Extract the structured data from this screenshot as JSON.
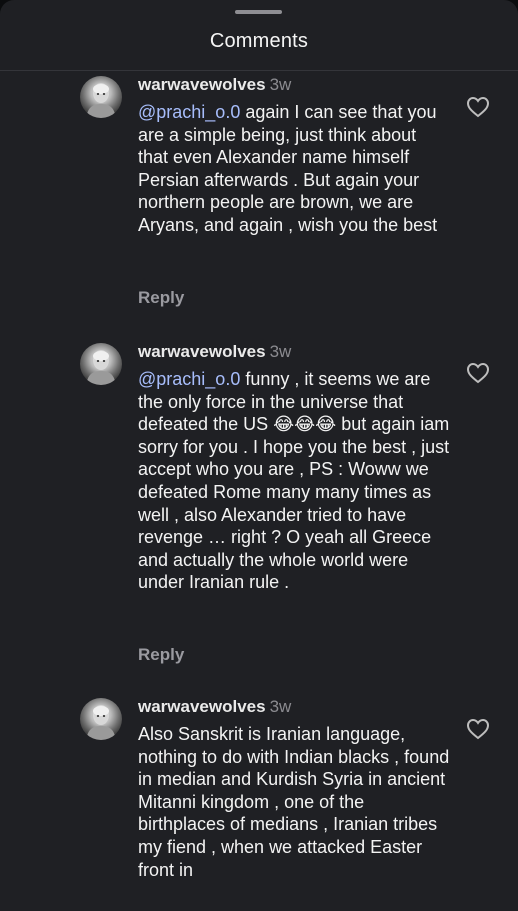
{
  "header": {
    "title": "Comments"
  },
  "comments": [
    {
      "username": "warwavewolves",
      "time": "3w",
      "mention": "@prachi_o.0",
      "text": " again I can see that you are a simple being, just think about that even Alexander name himself Persian afterwards . But again your northern people are brown, we are Aryans, and again , wish you the best",
      "reply_label": "Reply"
    },
    {
      "username": "warwavewolves",
      "time": "3w",
      "mention": "@prachi_o.0",
      "text_before_emoji": " funny , it seems we are the only force in the universe that defeated the US ",
      "emoji": "😂😂😂",
      "text_after_emoji": " but again iam sorry for you . I hope you the best , just accept who you are , PS : Woww we defeated Rome many many times as well , also Alexander tried to have revenge … right ? O yeah all Greece and actually the whole world were under Iranian rule .",
      "reply_label": "Reply"
    },
    {
      "username": "warwavewolves",
      "time": "3w",
      "text": "Also Sanskrit is Iranian language, nothing to do with Indian blacks , found in median and Kurdish Syria in ancient Mitanni kingdom , one of the birthplaces of medians , Iranian tribes my fiend , when we attacked Easter front in"
    }
  ],
  "icons": {
    "avatar": "avatar-icon",
    "like": "heart-icon",
    "laugh": "tears-of-joy-emoji"
  },
  "colors": {
    "background": "#1f2024",
    "mention": "#a7bdfb",
    "muted": "#8b8b90"
  }
}
